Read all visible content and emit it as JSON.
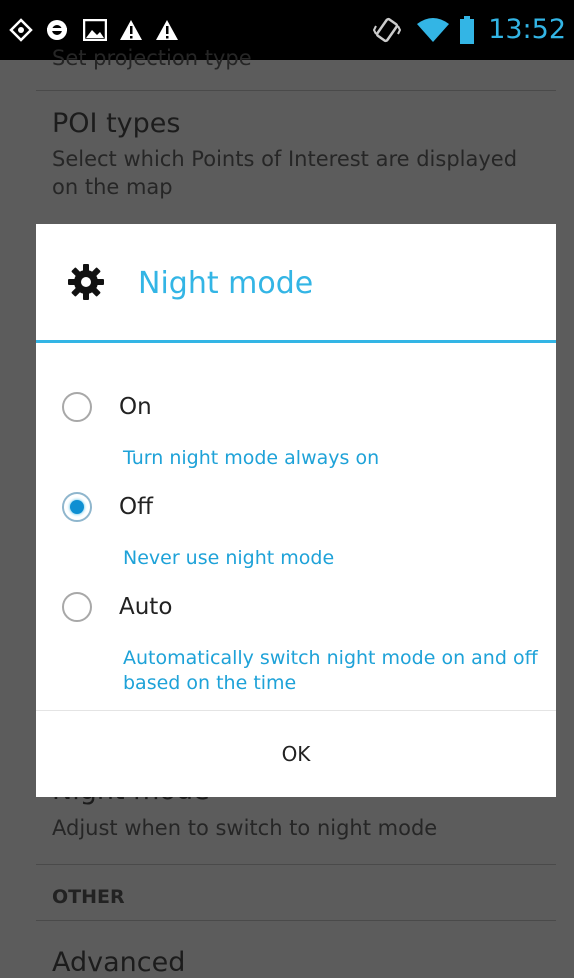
{
  "status_bar": {
    "icons": [
      "gps-icon",
      "steering-icon",
      "image-icon",
      "warning-icon",
      "warning-icon",
      "vibrate-icon",
      "wifi-icon",
      "battery-icon"
    ],
    "time": "13:52"
  },
  "background": {
    "partial_subtitle": "Set projection type",
    "poi": {
      "title": "POI types",
      "subtitle": "Select which Points of Interest are displayed on the map"
    },
    "night_mode": {
      "title": "Night mode",
      "subtitle": "Adjust when to switch to night mode"
    },
    "section_other": "OTHER",
    "advanced": "Advanced"
  },
  "dialog": {
    "icon": "gear-icon",
    "title": "Night mode",
    "options": [
      {
        "label": "On",
        "description": "Turn night mode always on",
        "checked": false
      },
      {
        "label": "Off",
        "description": "Never use night mode",
        "checked": true
      },
      {
        "label": "Auto",
        "description": "Automatically switch night mode on and off based on the time",
        "checked": false
      }
    ],
    "ok_label": "OK"
  },
  "colors": {
    "accent": "#33b5e5",
    "scrim_background": "#5c5c5c"
  }
}
